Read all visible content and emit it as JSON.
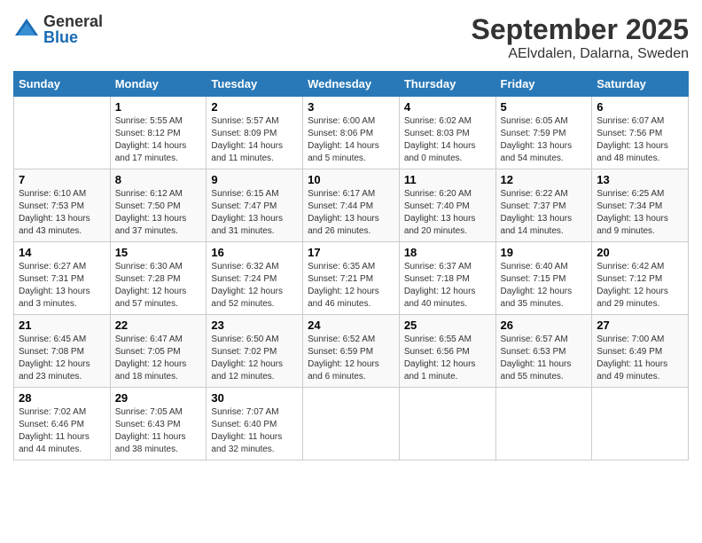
{
  "header": {
    "logo_general": "General",
    "logo_blue": "Blue",
    "title": "September 2025",
    "location": "AElvdalen, Dalarna, Sweden"
  },
  "calendar": {
    "days_of_week": [
      "Sunday",
      "Monday",
      "Tuesday",
      "Wednesday",
      "Thursday",
      "Friday",
      "Saturday"
    ],
    "weeks": [
      [
        {
          "day": "",
          "info": ""
        },
        {
          "day": "1",
          "info": "Sunrise: 5:55 AM\nSunset: 8:12 PM\nDaylight: 14 hours\nand 17 minutes."
        },
        {
          "day": "2",
          "info": "Sunrise: 5:57 AM\nSunset: 8:09 PM\nDaylight: 14 hours\nand 11 minutes."
        },
        {
          "day": "3",
          "info": "Sunrise: 6:00 AM\nSunset: 8:06 PM\nDaylight: 14 hours\nand 5 minutes."
        },
        {
          "day": "4",
          "info": "Sunrise: 6:02 AM\nSunset: 8:03 PM\nDaylight: 14 hours\nand 0 minutes."
        },
        {
          "day": "5",
          "info": "Sunrise: 6:05 AM\nSunset: 7:59 PM\nDaylight: 13 hours\nand 54 minutes."
        },
        {
          "day": "6",
          "info": "Sunrise: 6:07 AM\nSunset: 7:56 PM\nDaylight: 13 hours\nand 48 minutes."
        }
      ],
      [
        {
          "day": "7",
          "info": "Sunrise: 6:10 AM\nSunset: 7:53 PM\nDaylight: 13 hours\nand 43 minutes."
        },
        {
          "day": "8",
          "info": "Sunrise: 6:12 AM\nSunset: 7:50 PM\nDaylight: 13 hours\nand 37 minutes."
        },
        {
          "day": "9",
          "info": "Sunrise: 6:15 AM\nSunset: 7:47 PM\nDaylight: 13 hours\nand 31 minutes."
        },
        {
          "day": "10",
          "info": "Sunrise: 6:17 AM\nSunset: 7:44 PM\nDaylight: 13 hours\nand 26 minutes."
        },
        {
          "day": "11",
          "info": "Sunrise: 6:20 AM\nSunset: 7:40 PM\nDaylight: 13 hours\nand 20 minutes."
        },
        {
          "day": "12",
          "info": "Sunrise: 6:22 AM\nSunset: 7:37 PM\nDaylight: 13 hours\nand 14 minutes."
        },
        {
          "day": "13",
          "info": "Sunrise: 6:25 AM\nSunset: 7:34 PM\nDaylight: 13 hours\nand 9 minutes."
        }
      ],
      [
        {
          "day": "14",
          "info": "Sunrise: 6:27 AM\nSunset: 7:31 PM\nDaylight: 13 hours\nand 3 minutes."
        },
        {
          "day": "15",
          "info": "Sunrise: 6:30 AM\nSunset: 7:28 PM\nDaylight: 12 hours\nand 57 minutes."
        },
        {
          "day": "16",
          "info": "Sunrise: 6:32 AM\nSunset: 7:24 PM\nDaylight: 12 hours\nand 52 minutes."
        },
        {
          "day": "17",
          "info": "Sunrise: 6:35 AM\nSunset: 7:21 PM\nDaylight: 12 hours\nand 46 minutes."
        },
        {
          "day": "18",
          "info": "Sunrise: 6:37 AM\nSunset: 7:18 PM\nDaylight: 12 hours\nand 40 minutes."
        },
        {
          "day": "19",
          "info": "Sunrise: 6:40 AM\nSunset: 7:15 PM\nDaylight: 12 hours\nand 35 minutes."
        },
        {
          "day": "20",
          "info": "Sunrise: 6:42 AM\nSunset: 7:12 PM\nDaylight: 12 hours\nand 29 minutes."
        }
      ],
      [
        {
          "day": "21",
          "info": "Sunrise: 6:45 AM\nSunset: 7:08 PM\nDaylight: 12 hours\nand 23 minutes."
        },
        {
          "day": "22",
          "info": "Sunrise: 6:47 AM\nSunset: 7:05 PM\nDaylight: 12 hours\nand 18 minutes."
        },
        {
          "day": "23",
          "info": "Sunrise: 6:50 AM\nSunset: 7:02 PM\nDaylight: 12 hours\nand 12 minutes."
        },
        {
          "day": "24",
          "info": "Sunrise: 6:52 AM\nSunset: 6:59 PM\nDaylight: 12 hours\nand 6 minutes."
        },
        {
          "day": "25",
          "info": "Sunrise: 6:55 AM\nSunset: 6:56 PM\nDaylight: 12 hours\nand 1 minute."
        },
        {
          "day": "26",
          "info": "Sunrise: 6:57 AM\nSunset: 6:53 PM\nDaylight: 11 hours\nand 55 minutes."
        },
        {
          "day": "27",
          "info": "Sunrise: 7:00 AM\nSunset: 6:49 PM\nDaylight: 11 hours\nand 49 minutes."
        }
      ],
      [
        {
          "day": "28",
          "info": "Sunrise: 7:02 AM\nSunset: 6:46 PM\nDaylight: 11 hours\nand 44 minutes."
        },
        {
          "day": "29",
          "info": "Sunrise: 7:05 AM\nSunset: 6:43 PM\nDaylight: 11 hours\nand 38 minutes."
        },
        {
          "day": "30",
          "info": "Sunrise: 7:07 AM\nSunset: 6:40 PM\nDaylight: 11 hours\nand 32 minutes."
        },
        {
          "day": "",
          "info": ""
        },
        {
          "day": "",
          "info": ""
        },
        {
          "day": "",
          "info": ""
        },
        {
          "day": "",
          "info": ""
        }
      ]
    ]
  }
}
